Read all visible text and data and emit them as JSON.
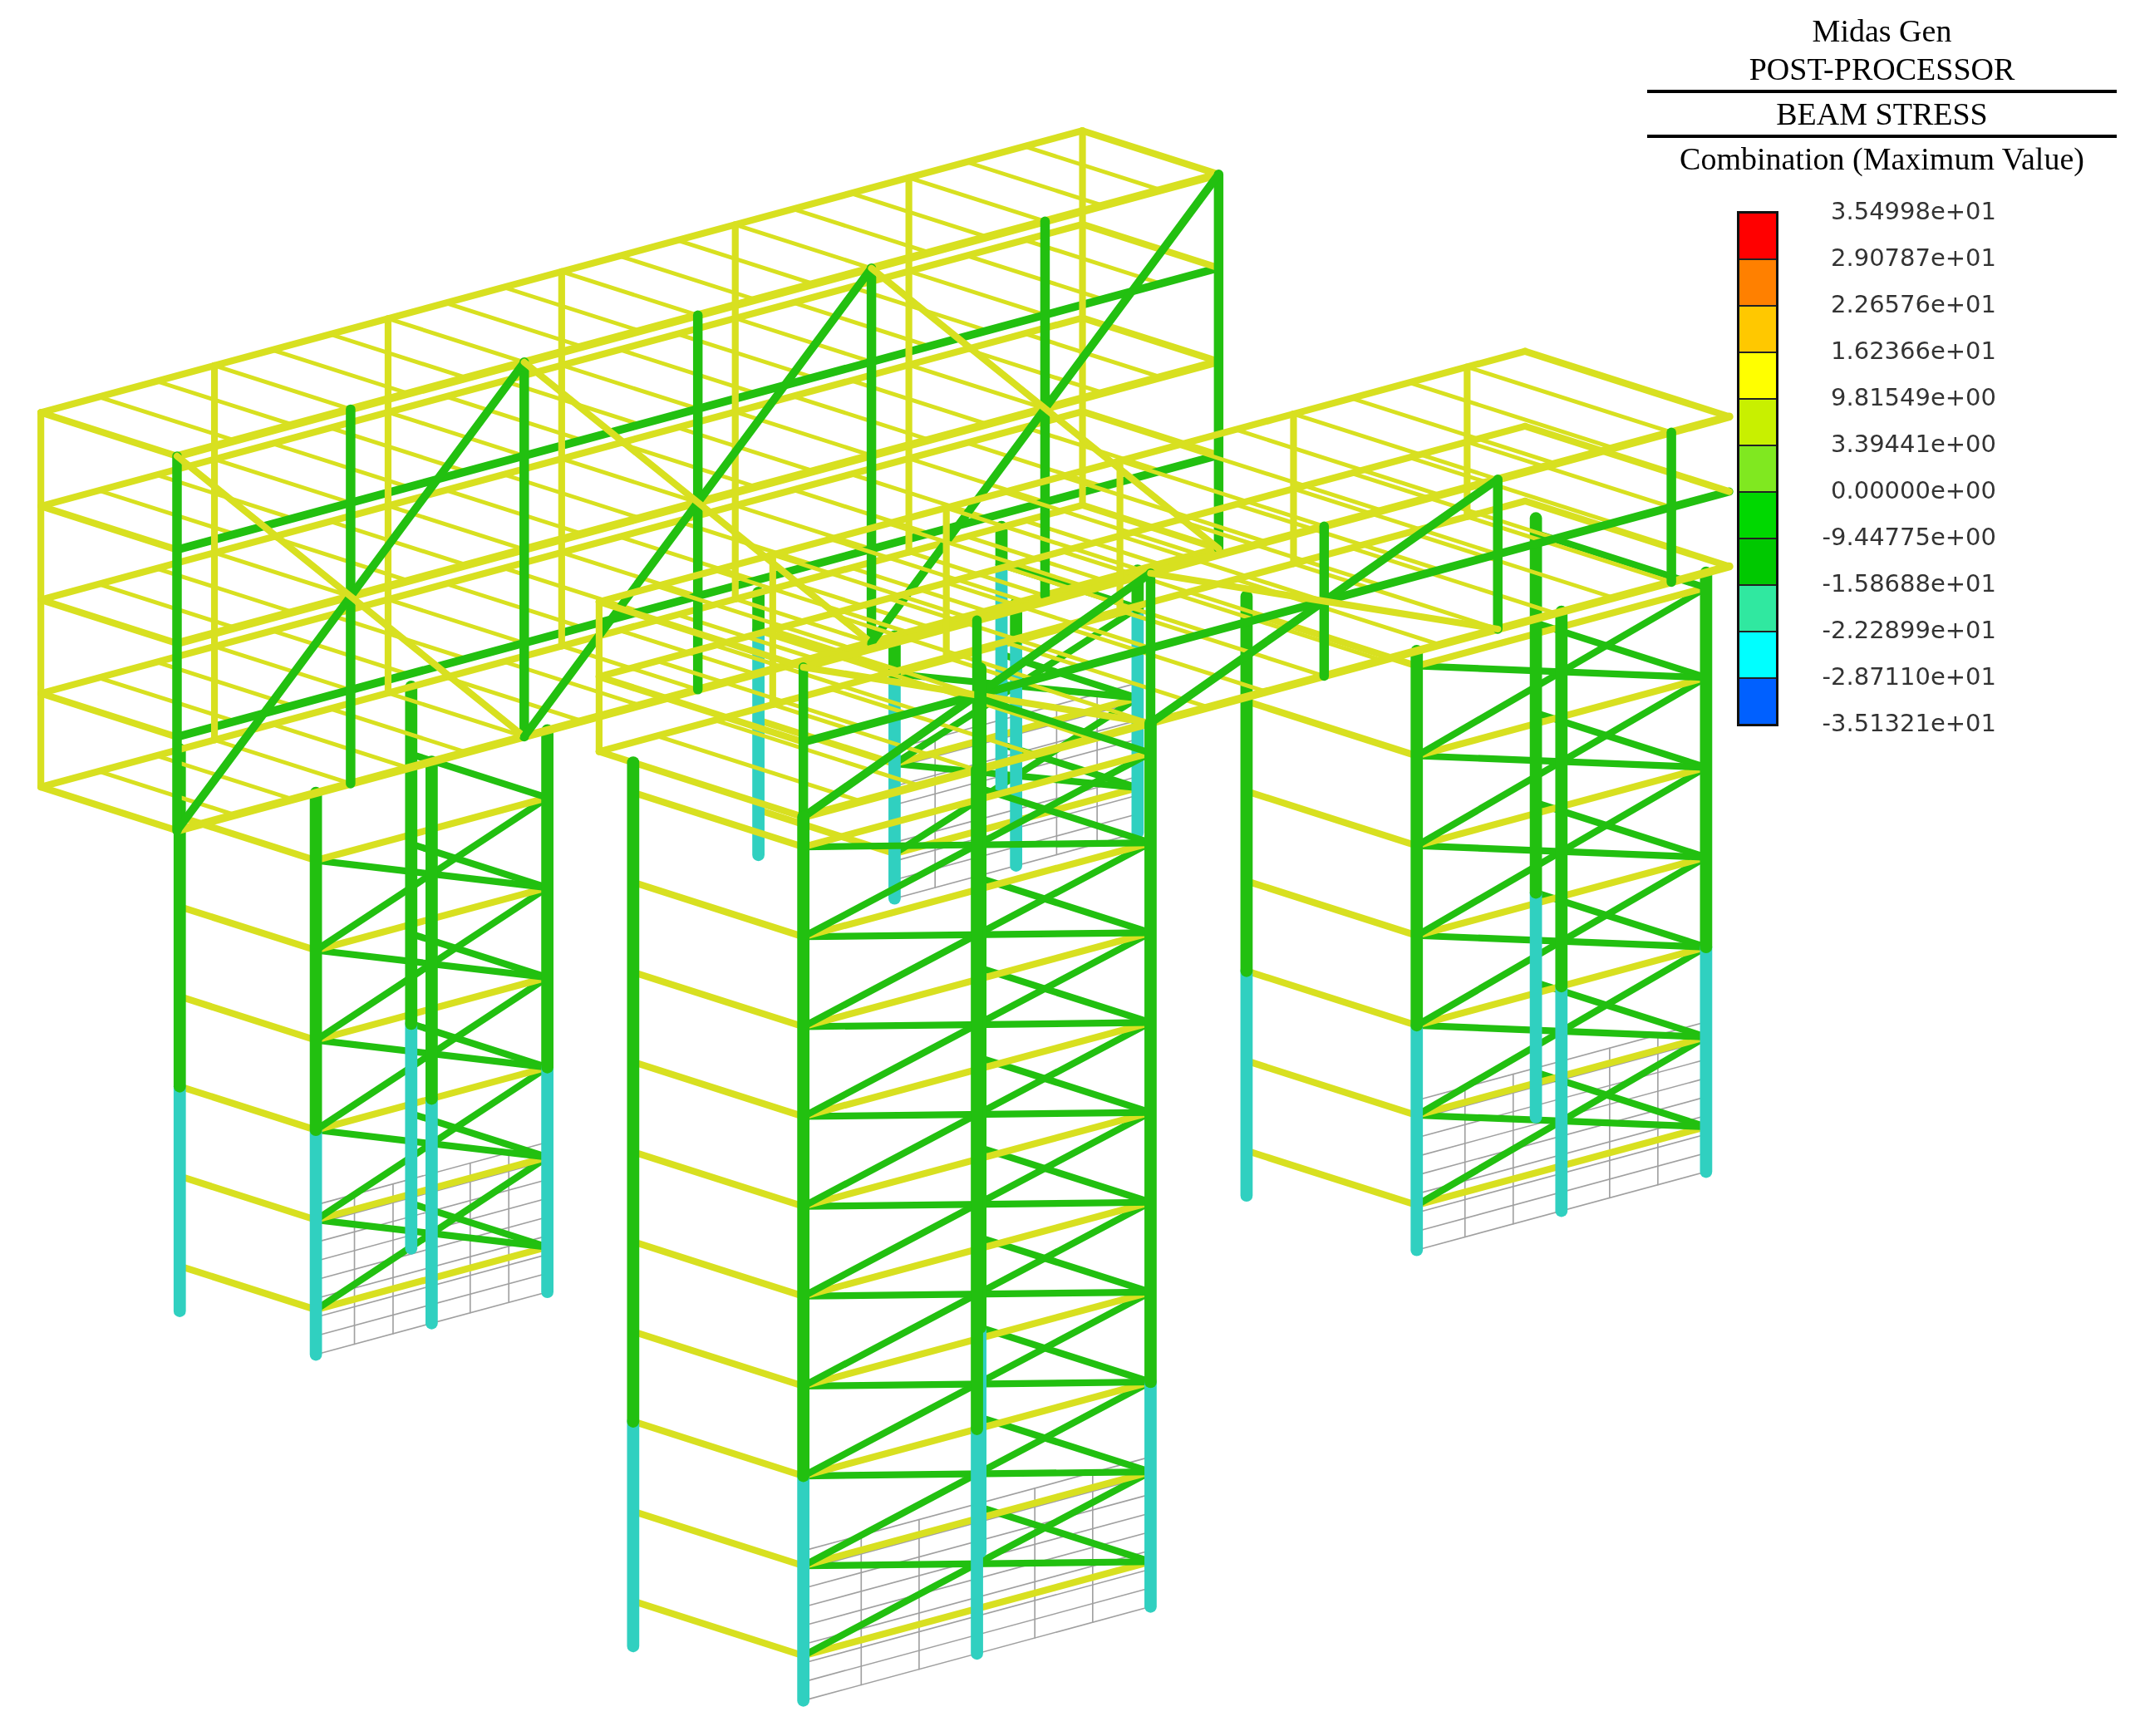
{
  "legend": {
    "program": "Midas Gen",
    "mode": "POST-PROCESSOR",
    "result": "BEAM STRESS",
    "load_case": "Combination (Maximum Value)",
    "bands": [
      {
        "color": "#ff0000"
      },
      {
        "color": "#ff8000"
      },
      {
        "color": "#ffc800"
      },
      {
        "color": "#ffff00"
      },
      {
        "color": "#c8f000"
      },
      {
        "color": "#80e820"
      },
      {
        "color": "#00d800"
      },
      {
        "color": "#00c800"
      },
      {
        "color": "#30e8a0"
      },
      {
        "color": "#00ffff"
      },
      {
        "color": "#0060ff"
      }
    ],
    "values": [
      "3.54998e+01",
      "2.90787e+01",
      "2.26576e+01",
      "1.62366e+01",
      "9.81549e+00",
      "3.39441e+00",
      "0.00000e+00",
      "-9.44775e+00",
      "-1.58688e+01",
      "-2.22899e+01",
      "-2.87110e+01",
      "-3.51321e+01"
    ]
  }
}
